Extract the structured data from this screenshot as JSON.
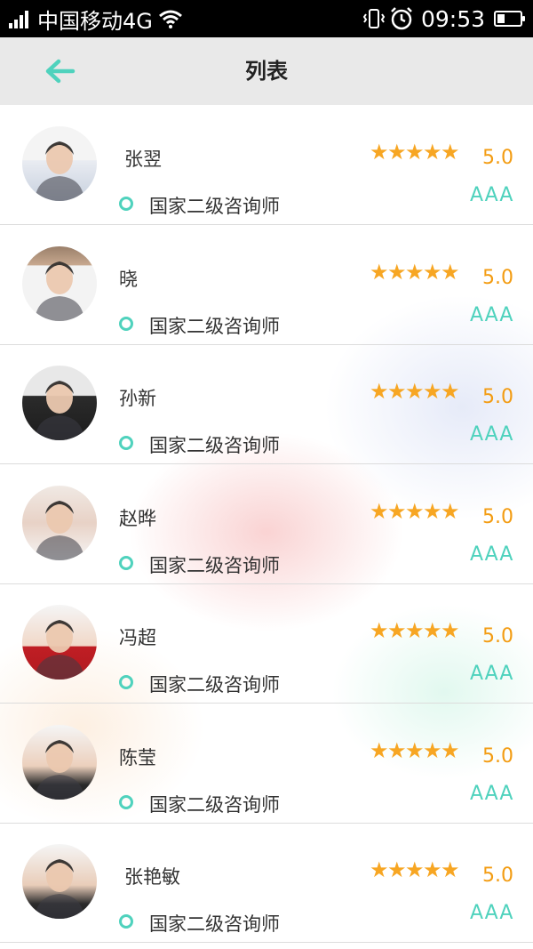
{
  "status_bar": {
    "carrier": "中国移动4G",
    "time": "09:53",
    "icons": [
      "signal-icon",
      "wifi-icon",
      "vibrate-icon",
      "alarm-icon",
      "battery-icon"
    ]
  },
  "header": {
    "title": "列表",
    "back_icon": "back-arrow-icon",
    "accent_color": "#4fd2bd"
  },
  "counselors": [
    {
      "name": "张翌",
      "title": "国家二级咨询师",
      "rating": "5.0",
      "grade": "AAA",
      "stars": 5
    },
    {
      "name": "晓",
      "title": "国家二级咨询师",
      "rating": "5.0",
      "grade": "AAA",
      "stars": 5
    },
    {
      "name": "孙新",
      "title": "国家二级咨询师",
      "rating": "5.0",
      "grade": "AAA",
      "stars": 5
    },
    {
      "name": "赵晔",
      "title": "国家二级咨询师",
      "rating": "5.0",
      "grade": "AAA",
      "stars": 5
    },
    {
      "name": "冯超",
      "title": "国家二级咨询师",
      "rating": "5.0",
      "grade": "AAA",
      "stars": 5
    },
    {
      "name": "陈莹",
      "title": "国家二级咨询师",
      "rating": "5.0",
      "grade": "AAA",
      "stars": 5
    },
    {
      "name": "张艳敏",
      "title": "国家二级咨询师",
      "rating": "5.0",
      "grade": "AAA",
      "stars": 5
    }
  ],
  "star_color": "#f7a623",
  "rating_color": "#f39c12"
}
